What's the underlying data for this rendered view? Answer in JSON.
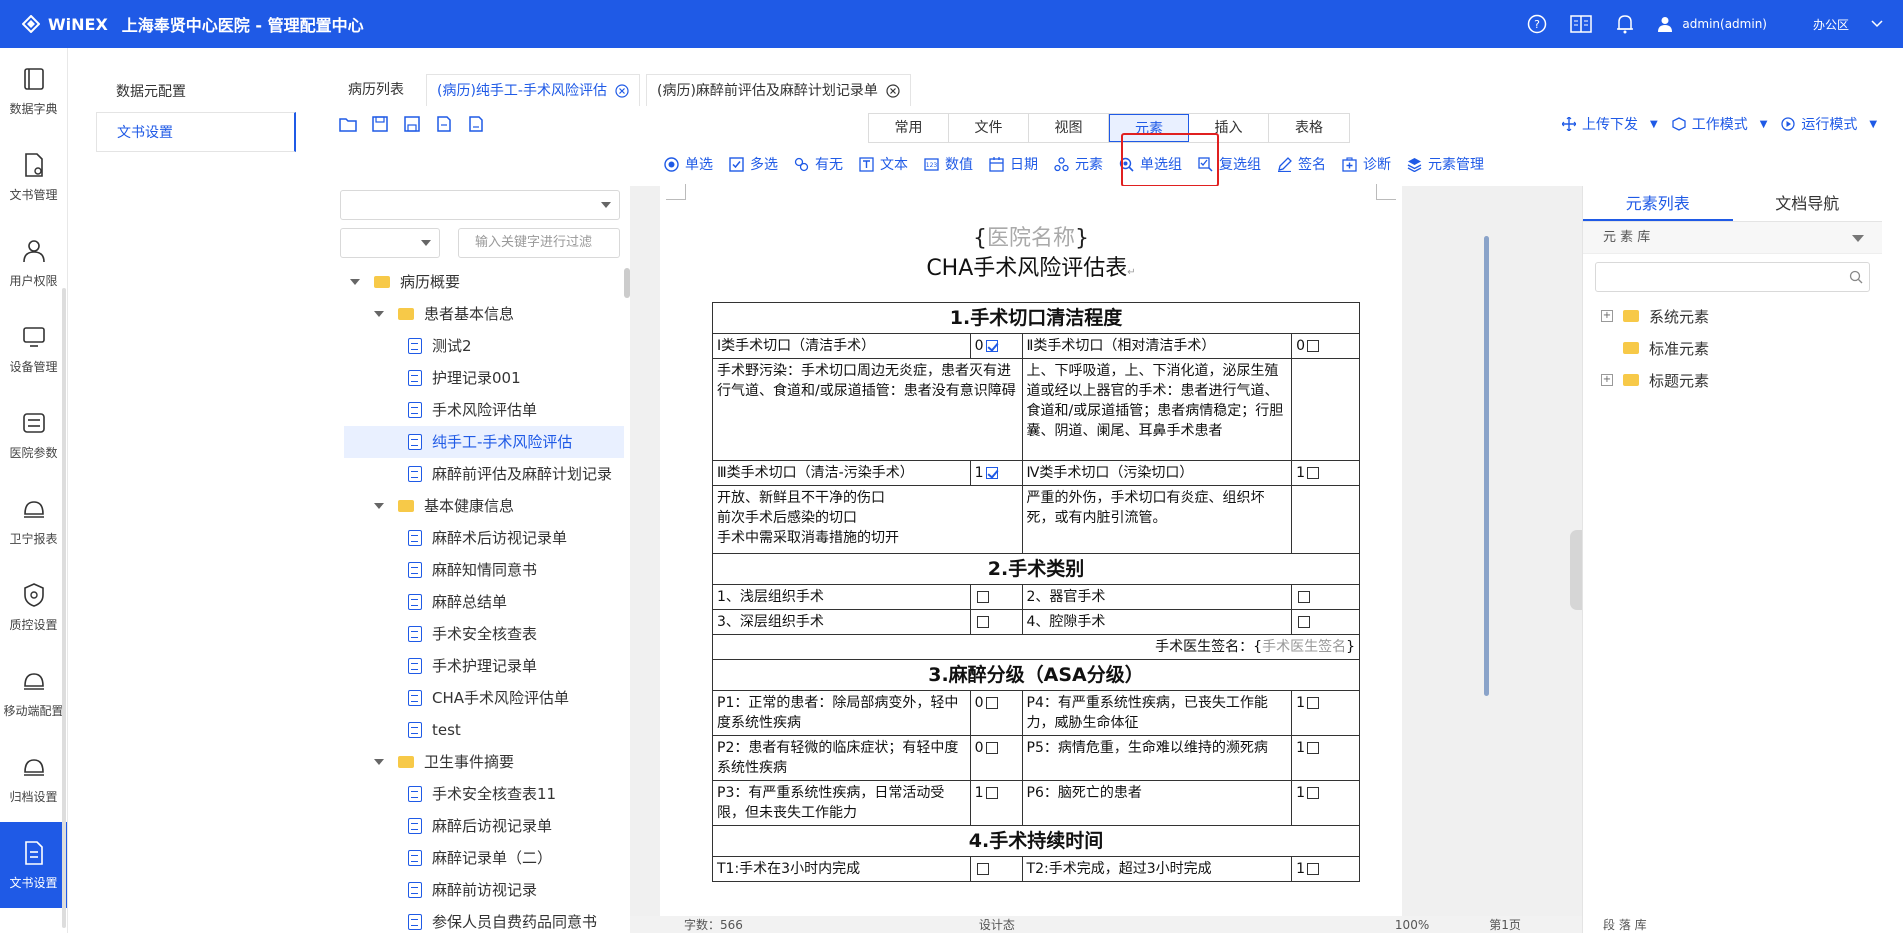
{
  "header": {
    "brand": "WiNEX",
    "title": "上海奉贤中心医院 - 管理配置中心",
    "user": "admin(admin)",
    "office": "办公区"
  },
  "rail": [
    {
      "name": "data-dict",
      "label": "数据字典"
    },
    {
      "name": "doc-mgmt",
      "label": "文书管理"
    },
    {
      "name": "user-perm",
      "label": "用户权限"
    },
    {
      "name": "device-mgmt",
      "label": "设备管理"
    },
    {
      "name": "hospital-params",
      "label": "医院参数"
    },
    {
      "name": "report",
      "label": "卫宁报表"
    },
    {
      "name": "qc-settings",
      "label": "质控设置"
    },
    {
      "name": "mobile-config",
      "label": "移动端配置"
    },
    {
      "name": "archive-settings",
      "label": "归档设置"
    },
    {
      "name": "doc-settings",
      "label": "文书设置"
    }
  ],
  "subnav": [
    "数据元配置",
    "文书设置"
  ],
  "tabs": {
    "list": "病历列表",
    "tab1": "(病历)纯手工-手术风险评估",
    "tab2": "(病历)麻醉前评估及麻醉计划记录单"
  },
  "menu_tabs": [
    "常用",
    "文件",
    "视图",
    "元素",
    "插入",
    "表格"
  ],
  "modes": [
    "上传下发",
    "工作模式",
    "运行模式"
  ],
  "elem_tools": [
    "单选",
    "多选",
    "有无",
    "文本",
    "数值",
    "日期",
    "元素",
    "单选组",
    "复选组",
    "签名",
    "诊断",
    "元素管理"
  ],
  "tree": {
    "filter_placeholder": "输入关键字进行过滤",
    "nodes": [
      {
        "label": "病历概要",
        "type": "folder",
        "level": 0
      },
      {
        "label": "患者基本信息",
        "type": "folder",
        "level": 1
      },
      {
        "label": "测试2",
        "type": "doc",
        "level": 2
      },
      {
        "label": "护理记录001",
        "type": "doc",
        "level": 2
      },
      {
        "label": "手术风险评估单",
        "type": "doc",
        "level": 2
      },
      {
        "label": "纯手工-手术风险评估",
        "type": "doc",
        "level": 2,
        "selected": true
      },
      {
        "label": "麻醉前评估及麻醉计划记录",
        "type": "doc",
        "level": 2
      },
      {
        "label": "基本健康信息",
        "type": "folder",
        "level": 1
      },
      {
        "label": "麻醉术后访视记录单",
        "type": "doc",
        "level": 2
      },
      {
        "label": "麻醉知情同意书",
        "type": "doc",
        "level": 2
      },
      {
        "label": "麻醉总结单",
        "type": "doc",
        "level": 2
      },
      {
        "label": "手术安全核查表",
        "type": "doc",
        "level": 2
      },
      {
        "label": "手术护理记录单",
        "type": "doc",
        "level": 2
      },
      {
        "label": "CHA手术风险评估单",
        "type": "doc",
        "level": 2
      },
      {
        "label": "test",
        "type": "doc",
        "level": 2
      },
      {
        "label": "卫生事件摘要",
        "type": "folder",
        "level": 1
      },
      {
        "label": "手术安全核查表11",
        "type": "doc",
        "level": 2
      },
      {
        "label": "麻醉后访视记录单",
        "type": "doc",
        "level": 2
      },
      {
        "label": "麻醉记录单（二）",
        "type": "doc",
        "level": 2
      },
      {
        "label": "麻醉前访视记录",
        "type": "doc",
        "level": 2
      },
      {
        "label": "参保人员自费药品同意书",
        "type": "doc",
        "level": 2
      }
    ]
  },
  "document": {
    "hospital_placeholder": "医院名称",
    "form_title": "CHA手术风险评估表",
    "s1": "1.手术切口清洁程度",
    "s1_r1a": "Ⅰ类手术切口（清洁手术）",
    "s1_r1b": "Ⅱ类手术切口（相对清洁手术）",
    "s1_r2a": "手术野污染：手术切口周边无炎症，患者灭有进行气道、食道和/或尿道插管：患者没有意识障碍",
    "s1_r2b": "上、下呼吸道，上、下消化道，泌尿生殖道或经以上器官的手术：患者进行气道、食道和/或尿道插管；患者病情稳定；行胆囊、阴道、阑尾、耳鼻手术患者",
    "s1_r3a": "Ⅲ类手术切口（清洁-污染手术）",
    "s1_r3b": "Ⅳ类手术切口（污染切口）",
    "s1_r4a1": "开放、新鲜且不干净的伤口",
    "s1_r4a2": "前次手术后感染的切口",
    "s1_r4a3": "手术中需采取消毒措施的切开",
    "s1_r4b": "严重的外伤，手术切口有炎症、组织坏死，或有内脏引流管。",
    "s2": "2.手术类别",
    "s2_a": "1、浅层组织手术",
    "s2_b": "2、器官手术",
    "s2_c": "3、深层组织手术",
    "s2_d": "4、腔隙手术",
    "sign_label": "手术医生签名：",
    "sign_placeholder": "手术医生签名",
    "s3": "3.麻醉分级（ASA分级）",
    "p1": "P1：正常的患者：除局部病变外，轻中度系统性疾病",
    "p4": "P4：有严重系统性疾病，已丧失工作能力，威胁生命体征",
    "p2": "P2：患者有轻微的临床症状；有轻中度系统性疾病",
    "p5": "P5：病情危重，生命难以维持的濒死病",
    "p3": "P3：有严重系统性疾病，日常活动受限，但未丧失工作能力",
    "p6": "P6：脑死亡的患者",
    "s4": "4.手术持续时间",
    "t1": "T1:手术在3小时内完成",
    "t2": "T2:手术完成，超过3小时完成",
    "score_0": "0",
    "score_1": "1"
  },
  "status": {
    "words": "字数：566",
    "mode": "设计态",
    "zoom": "100%",
    "page": "第1页"
  },
  "right_panel": {
    "tab_elements": "元素列表",
    "tab_nav": "文档导航",
    "library": "元 素 库",
    "nodes": [
      "系统元素",
      "标准元素",
      "标题元素"
    ],
    "footer": "段 落 库"
  }
}
